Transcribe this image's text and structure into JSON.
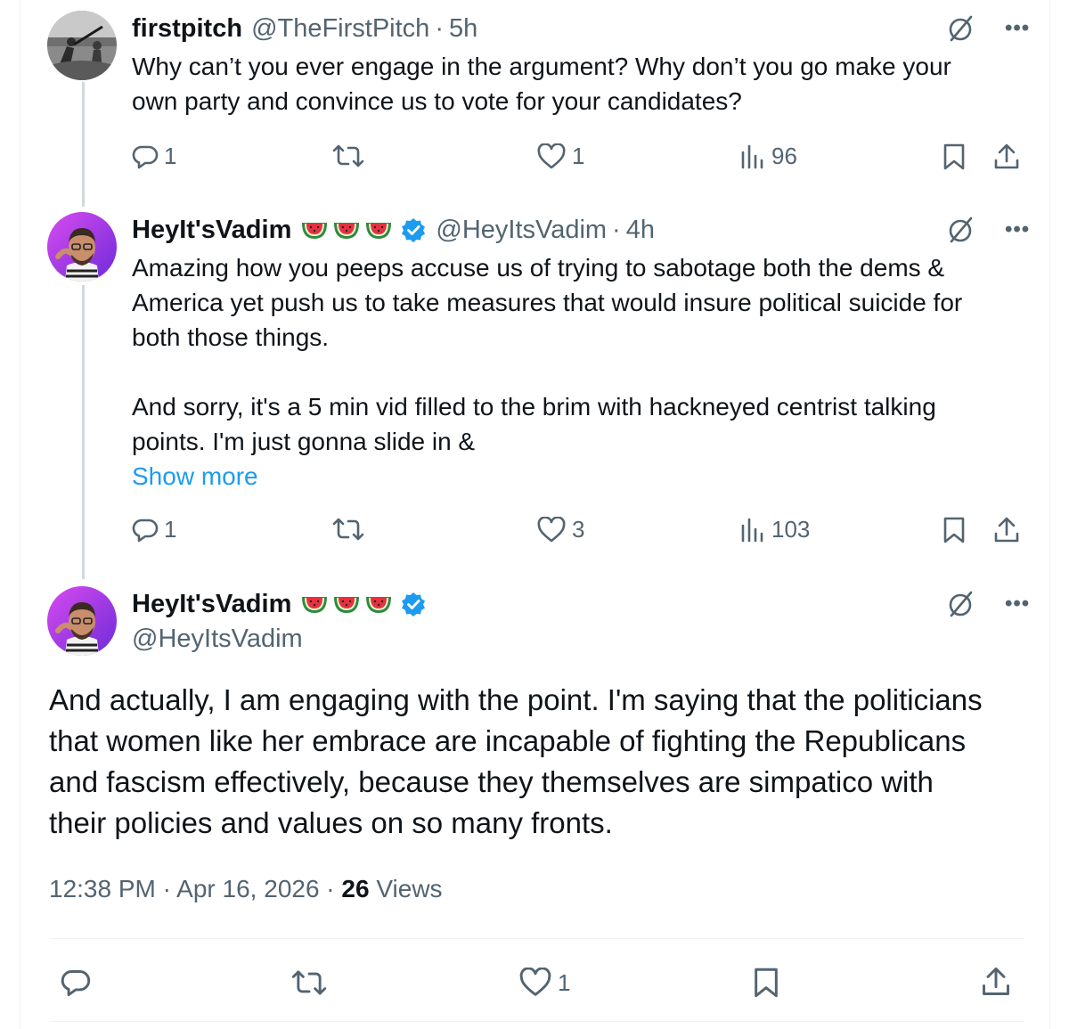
{
  "reply1": {
    "display_name": "firstpitch",
    "handle": "@TheFirstPitch",
    "separator": "·",
    "time": "5h",
    "text_lines": [
      "Why can’t you ever engage in the argument? Why don’t you go make your",
      "own party and convince us to vote for your candidates?"
    ],
    "actions": {
      "replies": "1",
      "likes": "1",
      "views": "96"
    }
  },
  "reply2": {
    "display_name": "HeyIt'sVadim",
    "handle": "@HeyItsVadim",
    "separator": "·",
    "time": "4h",
    "text_lines": [
      "Amazing how you peeps accuse us of trying to sabotage both the dems &",
      "America yet push us to take measures that would insure political suicide for",
      "both those things.",
      "And sorry, it's a 5 min vid filled to the brim with hackneyed centrist talking",
      "points. I'm just gonna slide in &"
    ],
    "show_more": "Show more",
    "actions": {
      "replies": "1",
      "likes": "3",
      "views": "103"
    }
  },
  "main": {
    "display_name": "HeyIt'sVadim",
    "handle": "@HeyItsVadim",
    "text_lines": [
      "And actually, I am engaging with the point.  I'm saying that the politicians",
      "that women like her embrace are incapable of fighting the Republicans",
      "and fascism effectively, because they themselves are simpatico with",
      "their policies and values on so many fronts."
    ],
    "timestamp": "12:38 PM · Apr 16, 2026 · ",
    "views_count": "26",
    "views_label": " Views",
    "actions": {
      "likes": "1"
    }
  },
  "icons": {
    "reply": "reply-icon",
    "repost": "repost-icon",
    "like": "heart-icon",
    "views": "views-icon",
    "bookmark": "bookmark-icon",
    "share": "share-icon",
    "grok": "grok-icon",
    "more": "more-icon",
    "verified": "verified-badge-icon",
    "emoji": "watermelon-emoji"
  },
  "colors": {
    "text": "#0f1419",
    "secondary": "#536471",
    "link": "#1d9bf0",
    "verified": "#1d9bf0",
    "thread_line": "#cfd9de",
    "divider": "#eff3f4"
  }
}
